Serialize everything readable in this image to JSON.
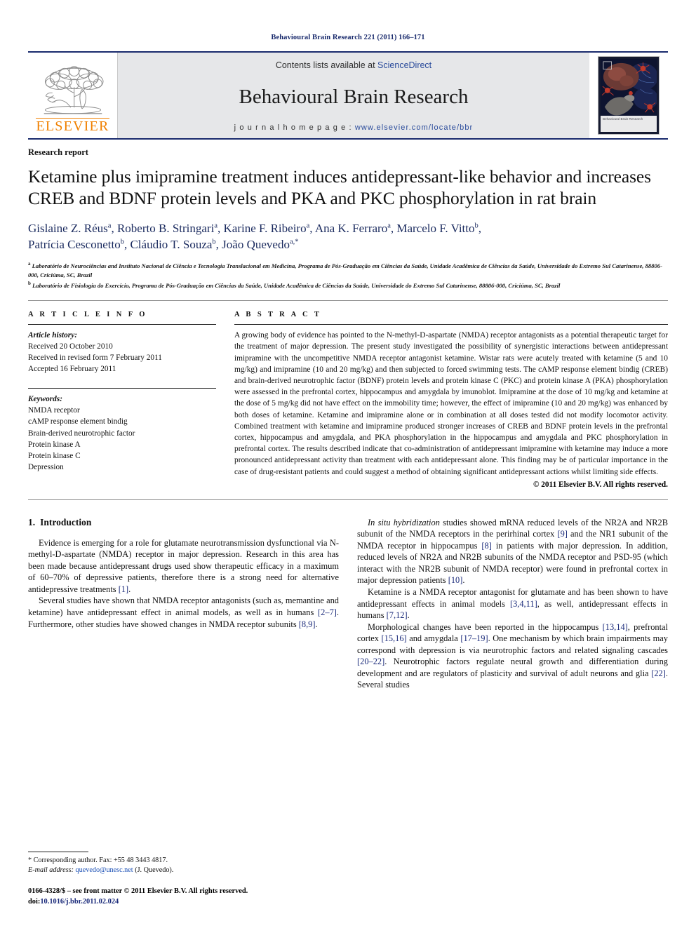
{
  "running_head": "Behavioural Brain Research 221 (2011) 166–171",
  "masthead": {
    "contents_prefix": "Contents lists available at ",
    "sciencedirect": "ScienceDirect",
    "journal_name": "Behavioural Brain Research",
    "homepage_prefix": "j o u r n a l   h o m e p a g e :",
    "homepage_url": "www.elsevier.com/locate/bbr",
    "elsevier_wordmark": "ELSEVIER",
    "cover_caption": "Behavioural Brain Research",
    "accent_blue": "#1a2b6d",
    "elsevier_orange": "#F08000",
    "band_gray": "#e6e7e9"
  },
  "article": {
    "doctype": "Research report",
    "title": "Ketamine plus imipramine treatment induces antidepressant-like behavior and increases CREB and BDNF protein levels and PKA and PKC phosphorylation in rat brain",
    "authors_line1": "Gislaine Z. Réus<sup>a</sup>, Roberto B. Stringari<sup>a</sup>, Karine F. Ribeiro<sup>a</sup>, Ana K. Ferraro<sup>a</sup>, Marcelo F. Vitto<sup>b</sup>,",
    "authors_line2": "Patrícia Cesconetto<sup>b</sup>, Cláudio T. Souza<sup>b</sup>, João Quevedo<sup>a,</sup><sup>*</sup>",
    "affiliation_a": "<sup>a</sup> Laboratório de Neurociências and Instituto Nacional de Ciência e Tecnologia Translacional em Medicina, Programa de Pós-Graduação em Ciências da Saúde, Unidade Acadêmica de Ciências da Saúde, Universidade do Extremo Sul Catarinense, 88806-000, Criciúma, SC, Brazil",
    "affiliation_b": "<sup>b</sup> Laboratório de Fisiologia do Exercício, Programa de Pós-Graduação em Ciências da Saúde, Unidade Acadêmica de Ciências da Saúde, Universidade do Extremo Sul Catarinense, 88806-000, Criciúma, SC, Brazil"
  },
  "article_info": {
    "heading": "A R T I C L E   I N F O",
    "history_label": "Article history:",
    "history": [
      "Received 20 October 2010",
      "Received in revised form 7 February 2011",
      "Accepted 16 February 2011"
    ],
    "keywords_label": "Keywords:",
    "keywords": [
      "NMDA receptor",
      "cAMP response element bindig",
      "Brain-derived neurotrophic factor",
      "Protein kinase A",
      "Protein kinase C",
      "Depression"
    ]
  },
  "abstract": {
    "heading": "A B S T R A C T",
    "text": "A growing body of evidence has pointed to the N-methyl-<span class=\"smallcap\">D</span>-aspartate (NMDA) receptor antagonists as a potential therapeutic target for the treatment of major depression. The present study investigated the possibility of synergistic interactions between antidepressant imipramine with the uncompetitive NMDA receptor antagonist ketamine. Wistar rats were acutely treated with ketamine (5 and 10 mg/kg) and imipramine (10 and 20 mg/kg) and then subjected to forced swimming tests. The cAMP response element bindig (CREB) and brain-derived neurotrophic factor (BDNF) protein levels and protein kinase C (PKC) and protein kinase A (PKA) phosphorylation were assessed in the prefrontal cortex, hippocampus and amygdala by imunoblot. Imipramine at the dose of 10 mg/kg and ketamine at the dose of 5 mg/kg did not have effect on the immobility time; however, the effect of imipramine (10 and 20 mg/kg) was enhanced by both doses of ketamine. Ketamine and imipramine alone or in combination at all doses tested did not modify locomotor activity. Combined treatment with ketamine and imipramine produced stronger increases of CREB and BDNF protein levels in the prefrontal cortex, hippocampus and amygdala, and PKA phosphorylation in the hippocampus and amygdala and PKC phosphorylation in prefrontal cortex. The results described indicate that co-administration of antidepressant imipramine with ketamine may induce a more pronounced antidepressant activity than treatment with each antidepressant alone. This finding may be of particular importance in the case of drug-resistant patients and could suggest a method of obtaining significant antidepressant actions whilst limiting side effects.",
    "copyright": "© 2011 Elsevier B.V. All rights reserved."
  },
  "body": {
    "section_number": "1.",
    "section_title": "Introduction",
    "left_paragraphs": [
      "Evidence is emerging for a role for glutamate neurotransmission dysfunctional via N-methyl-<span class=\"smallcap\">D</span>-aspartate (NMDA) receptor in major depression. Research in this area has been made because antidepressant drugs used show therapeutic efficacy in a maximum of 60–70% of depressive patients, therefore there is a strong need for alternative antidepressive treatments <span class=\"ref\">[1]</span>.",
      "Several studies have shown that NMDA receptor antagonists (such as, memantine and ketamine) have antidepressant effect in animal models, as well as in humans <span class=\"ref\">[2–7]</span>. Furthermore, other studies have showed changes in NMDA receptor subunits <span class=\"ref\">[8,9]</span>."
    ],
    "right_paragraphs": [
      "<span class=\"ital\">In situ hybridization</span> studies showed mRNA reduced levels of the NR2A and NR2B subunit of the NMDA receptors in the perirhinal cortex <span class=\"ref\">[9]</span> and the NR1 subunit of the NMDA receptor in hippocampus <span class=\"ref\">[8]</span> in patients with major depression. In addition, reduced levels of NR2A and NR2B subunits of the NMDA receptor and PSD-95 (which interact with the NR2B subunit of NMDA receptor) were found in prefrontal cortex in major depression patients <span class=\"ref\">[10]</span>.",
      "Ketamine is a NMDA receptor antagonist for glutamate and has been shown to have antidepressant effects in animal models <span class=\"ref\">[3,4,11]</span>, as well, antidepressant effects in humans <span class=\"ref\">[7,12]</span>.",
      "Morphological changes have been reported in the hippocampus <span class=\"ref\">[13,14]</span>, prefrontal cortex <span class=\"ref\">[15,16]</span> and amygdala <span class=\"ref\">[17–19]</span>. One mechanism by which brain impairments may correspond with depression is via neurotrophic factors and related signaling cascades <span class=\"ref\">[20–22]</span>. Neurotrophic factors regulate neural growth and differentiation during development and are regulators of plasticity and survival of adult neurons and glia <span class=\"ref\">[22]</span>. Several studies"
    ]
  },
  "footer": {
    "corresponding_note": "* Corresponding author. Fax: +55 48 3443 4817.",
    "email_label": "E-mail address:",
    "email": "quevedo@unesc.net",
    "email_owner": "(J. Quevedo).",
    "issn_line": "0166-4328/$ – see front matter © 2011 Elsevier B.V. All rights reserved.",
    "doi_label": "doi:",
    "doi": "10.1016/j.bbr.2011.02.024"
  }
}
